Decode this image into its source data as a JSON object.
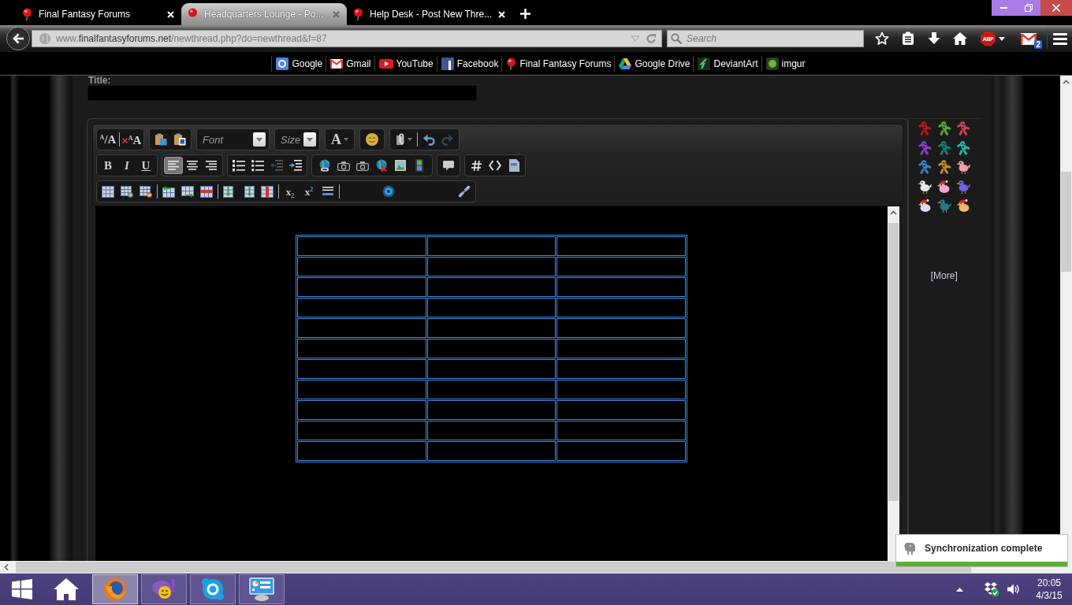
{
  "browser": {
    "tabs": [
      {
        "title": "Final Fantasy Forums",
        "selected": false
      },
      {
        "title": "Headquarters Lounge - Po...",
        "selected": true
      },
      {
        "title": "Help Desk - Post New Thre...",
        "selected": false
      }
    ],
    "address": {
      "prefix": "www.",
      "domain": "finalfantasyforums.net",
      "path": "/newthread.php?do=newthread&f=87"
    },
    "search": {
      "placeholder": "Search"
    },
    "adblock_badge": "ABP",
    "mail_count": "2",
    "bookmarks": [
      {
        "label": "Google"
      },
      {
        "label": "Gmail"
      },
      {
        "label": "YouTube"
      },
      {
        "label": "Facebook"
      },
      {
        "label": "Final Fantasy Forums"
      },
      {
        "label": "Google Drive"
      },
      {
        "label": "DeviantArt"
      },
      {
        "label": "imgur"
      }
    ]
  },
  "page": {
    "title_label": "Title:",
    "editor": {
      "text_size_button": "$^{A}$/A",
      "remove_format_button": "$^{A}$A",
      "font_select": "Font",
      "size_select": "Size",
      "text_color_button": "A",
      "undo": {
        "disabled": false
      },
      "redo": {
        "disabled": true
      },
      "style_buttons": [
        "B",
        "I",
        "U"
      ],
      "alignment": [
        {
          "selected": true
        },
        {
          "selected": false
        },
        {
          "selected": false
        }
      ],
      "outdent": {
        "disabled": true
      },
      "indent": {
        "disabled": false
      },
      "script_buttons": [
        "x$_{2}$",
        "x$^{2}$"
      ],
      "table": {
        "rows": [
          {
            "cells": [
              {
                "kind": "empty"
              },
              {
                "kind": "empty"
              },
              {
                "kind": "empty"
              }
            ]
          },
          {
            "cells": [
              {
                "kind": "empty"
              },
              {
                "kind": "empty"
              },
              {
                "kind": "empty"
              }
            ]
          },
          {
            "cells": [
              {
                "kind": "empty"
              },
              {
                "kind": "empty"
              },
              {
                "kind": "empty"
              }
            ]
          },
          {
            "cells": [
              {
                "kind": "empty"
              },
              {
                "kind": "empty"
              },
              {
                "kind": "empty"
              }
            ]
          },
          {
            "cells": [
              {
                "kind": "empty"
              },
              {
                "kind": "empty"
              },
              {
                "kind": "empty"
              }
            ]
          },
          {
            "cells": [
              {
                "kind": "empty"
              },
              {
                "kind": "empty"
              },
              {
                "kind": "empty"
              }
            ]
          },
          {
            "cells": [
              {
                "kind": "empty"
              },
              {
                "kind": "empty"
              },
              {
                "kind": "empty"
              }
            ]
          },
          {
            "cells": [
              {
                "kind": "empty"
              },
              {
                "kind": "empty"
              },
              {
                "kind": "empty"
              }
            ]
          },
          {
            "cells": [
              {
                "kind": "empty"
              },
              {
                "kind": "empty"
              },
              {
                "kind": "empty"
              }
            ]
          },
          {
            "cells": [
              {
                "kind": "empty"
              },
              {
                "kind": "empty"
              },
              {
                "kind": "empty"
              }
            ]
          },
          {
            "cells": [
              {
                "kind": "empty"
              },
              {
                "kind": "empty"
              },
              {
                "kind": "empty"
              }
            ]
          }
        ]
      }
    },
    "smilies": [
      {
        "kind": "cactus",
        "color": "#b51818"
      },
      {
        "kind": "cactus",
        "color": "#58a63a"
      },
      {
        "kind": "cactus",
        "color": "#c8405a"
      },
      {
        "kind": "cactus",
        "color": "#8c3cc8"
      },
      {
        "kind": "cactus",
        "color": "#128078"
      },
      {
        "kind": "cactus",
        "color": "#28b0b0"
      },
      {
        "kind": "cactus",
        "color": "#3a7cc0"
      },
      {
        "kind": "cactus",
        "color": "#c08a22"
      },
      {
        "kind": "bird",
        "color": "#eea0b0"
      },
      {
        "kind": "bird",
        "color": "#e8e8e8"
      },
      {
        "kind": "bird_hat",
        "color": "#f2a8c8"
      },
      {
        "kind": "bird",
        "color": "#6a62e0"
      },
      {
        "kind": "bird_hat",
        "color": "#dcd8f0"
      },
      {
        "kind": "bird",
        "color": "#24788c"
      },
      {
        "kind": "bird_hat",
        "color": "#f0b868"
      }
    ],
    "more_link": "[More]"
  },
  "notification": {
    "message": "Synchronization complete"
  },
  "taskbar": {
    "windows": [
      {
        "selected": true
      },
      {
        "selected": false
      },
      {
        "selected": false
      },
      {
        "selected": false
      }
    ],
    "clock": {
      "time": "20:05",
      "date": "4/3/15"
    }
  }
}
